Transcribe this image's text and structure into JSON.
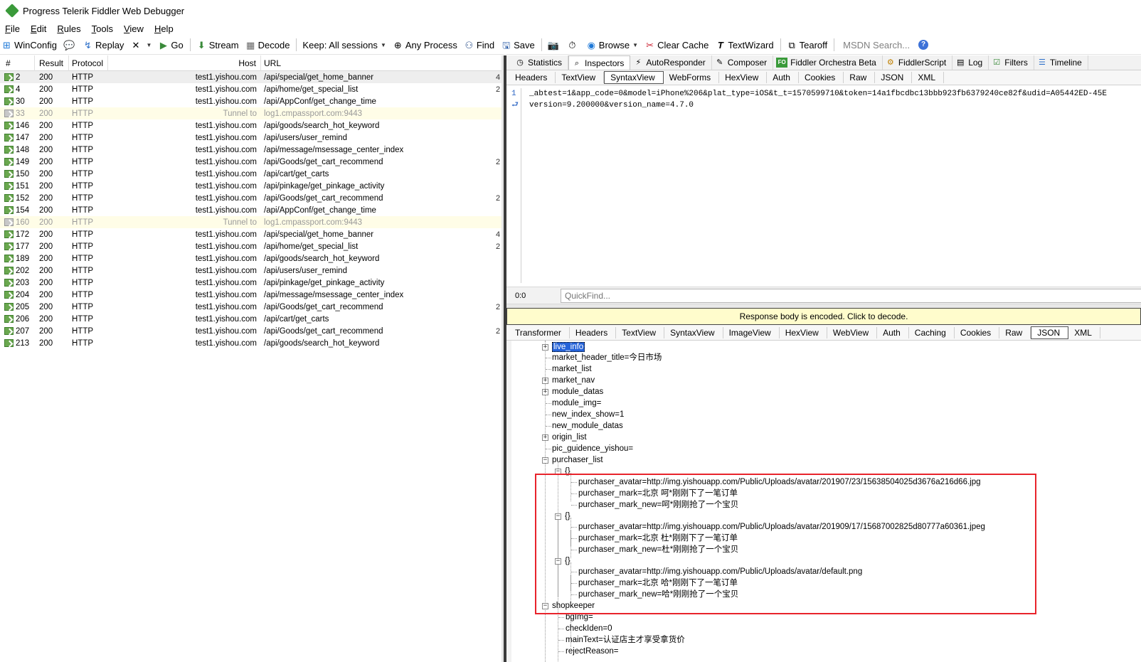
{
  "window": {
    "title": "Progress Telerik Fiddler Web Debugger"
  },
  "menu": [
    "File",
    "Edit",
    "Rules",
    "Tools",
    "View",
    "Help"
  ],
  "toolbar": {
    "winconfig": "WinConfig",
    "replay": "Replay",
    "go": "Go",
    "stream": "Stream",
    "decode": "Decode",
    "keep": "Keep: All sessions",
    "any_process": "Any Process",
    "find": "Find",
    "save": "Save",
    "browse": "Browse",
    "clear_cache": "Clear Cache",
    "textwizard": "TextWizard",
    "tearoff": "Tearoff",
    "msdn_search": "MSDN Search..."
  },
  "sessions": {
    "columns": {
      "num": "#",
      "result": "Result",
      "protocol": "Protocol",
      "host": "Host",
      "url": "URL"
    },
    "rows": [
      {
        "num": "2",
        "result": "200",
        "protocol": "HTTP",
        "host": "test1.yishou.com",
        "url": "/api/special/get_home_banner",
        "trunc": "4"
      },
      {
        "num": "4",
        "result": "200",
        "protocol": "HTTP",
        "host": "test1.yishou.com",
        "url": "/api/home/get_special_list",
        "trunc": "2"
      },
      {
        "num": "30",
        "result": "200",
        "protocol": "HTTP",
        "host": "test1.yishou.com",
        "url": "/api/AppConf/get_change_time",
        "trunc": ""
      },
      {
        "num": "33",
        "result": "200",
        "protocol": "HTTP",
        "host": "Tunnel to",
        "url": "log1.cmpassport.com:9443",
        "trunc": "",
        "tunnel": true
      },
      {
        "num": "146",
        "result": "200",
        "protocol": "HTTP",
        "host": "test1.yishou.com",
        "url": "/api/goods/search_hot_keyword",
        "trunc": ""
      },
      {
        "num": "147",
        "result": "200",
        "protocol": "HTTP",
        "host": "test1.yishou.com",
        "url": "/api/users/user_remind",
        "trunc": ""
      },
      {
        "num": "148",
        "result": "200",
        "protocol": "HTTP",
        "host": "test1.yishou.com",
        "url": "/api/message/msessage_center_index",
        "trunc": ""
      },
      {
        "num": "149",
        "result": "200",
        "protocol": "HTTP",
        "host": "test1.yishou.com",
        "url": "/api/Goods/get_cart_recommend",
        "trunc": "2"
      },
      {
        "num": "150",
        "result": "200",
        "protocol": "HTTP",
        "host": "test1.yishou.com",
        "url": "/api/cart/get_carts",
        "trunc": ""
      },
      {
        "num": "151",
        "result": "200",
        "protocol": "HTTP",
        "host": "test1.yishou.com",
        "url": "/api/pinkage/get_pinkage_activity",
        "trunc": ""
      },
      {
        "num": "152",
        "result": "200",
        "protocol": "HTTP",
        "host": "test1.yishou.com",
        "url": "/api/Goods/get_cart_recommend",
        "trunc": "2"
      },
      {
        "num": "154",
        "result": "200",
        "protocol": "HTTP",
        "host": "test1.yishou.com",
        "url": "/api/AppConf/get_change_time",
        "trunc": ""
      },
      {
        "num": "160",
        "result": "200",
        "protocol": "HTTP",
        "host": "Tunnel to",
        "url": "log1.cmpassport.com:9443",
        "trunc": "",
        "tunnel": true
      },
      {
        "num": "172",
        "result": "200",
        "protocol": "HTTP",
        "host": "test1.yishou.com",
        "url": "/api/special/get_home_banner",
        "trunc": "4"
      },
      {
        "num": "177",
        "result": "200",
        "protocol": "HTTP",
        "host": "test1.yishou.com",
        "url": "/api/home/get_special_list",
        "trunc": "2"
      },
      {
        "num": "189",
        "result": "200",
        "protocol": "HTTP",
        "host": "test1.yishou.com",
        "url": "/api/goods/search_hot_keyword",
        "trunc": ""
      },
      {
        "num": "202",
        "result": "200",
        "protocol": "HTTP",
        "host": "test1.yishou.com",
        "url": "/api/users/user_remind",
        "trunc": ""
      },
      {
        "num": "203",
        "result": "200",
        "protocol": "HTTP",
        "host": "test1.yishou.com",
        "url": "/api/pinkage/get_pinkage_activity",
        "trunc": ""
      },
      {
        "num": "204",
        "result": "200",
        "protocol": "HTTP",
        "host": "test1.yishou.com",
        "url": "/api/message/msessage_center_index",
        "trunc": ""
      },
      {
        "num": "205",
        "result": "200",
        "protocol": "HTTP",
        "host": "test1.yishou.com",
        "url": "/api/Goods/get_cart_recommend",
        "trunc": "2"
      },
      {
        "num": "206",
        "result": "200",
        "protocol": "HTTP",
        "host": "test1.yishou.com",
        "url": "/api/cart/get_carts",
        "trunc": ""
      },
      {
        "num": "207",
        "result": "200",
        "protocol": "HTTP",
        "host": "test1.yishou.com",
        "url": "/api/Goods/get_cart_recommend",
        "trunc": "2"
      },
      {
        "num": "213",
        "result": "200",
        "protocol": "HTTP",
        "host": "test1.yishou.com",
        "url": "/api/goods/search_hot_keyword",
        "trunc": ""
      }
    ]
  },
  "main_tabs": [
    "Statistics",
    "Inspectors",
    "AutoResponder",
    "Composer",
    "Fiddler Orchestra Beta",
    "FiddlerScript",
    "Log",
    "Filters",
    "Timeline"
  ],
  "fo_badge": "FO",
  "request_tabs": [
    "Headers",
    "TextView",
    "SyntaxView",
    "WebForms",
    "HexView",
    "Auth",
    "Cookies",
    "Raw",
    "JSON",
    "XML"
  ],
  "request_body": {
    "line_numbers": [
      "1"
    ],
    "lines": [
      "_abtest=1&app_code=0&model=iPhone%206&plat_type=iOS&t_t=1570599710&token=14a1fbcdbc13bbb923fb6379240ce82f&udid=A05442ED-45E",
      "version=9.200000&version_name=4.7.0"
    ]
  },
  "quickfind": {
    "position": "0:0",
    "placeholder": "QuickFind..."
  },
  "encoded_notice": "Response body is encoded. Click to decode.",
  "response_tabs": [
    "Transformer",
    "Headers",
    "TextView",
    "SyntaxView",
    "ImageView",
    "HexView",
    "WebView",
    "Auth",
    "Caching",
    "Cookies",
    "Raw",
    "JSON",
    "XML"
  ],
  "tree": {
    "live_info": "live_info",
    "market_header_title": "market_header_title=今日市场",
    "market_list": "market_list",
    "market_nav": "market_nav",
    "module_datas": "module_datas",
    "module_img": "module_img=",
    "new_index_show": "new_index_show=1",
    "new_module_datas": "new_module_datas",
    "origin_list": "origin_list",
    "pic_guidence_yishou": "pic_guidence_yishou=",
    "purchaser_list": "purchaser_list",
    "brace": "{}",
    "p1_avatar": "purchaser_avatar=http://img.yishouapp.com/Public/Uploads/avatar/201907/23/15638504025d3676a216d66.jpg",
    "p1_mark": "purchaser_mark=北京 呵*刚刚下了一笔订单",
    "p1_mark_new": "purchaser_mark_new=呵*刚刚抢了一个宝贝",
    "p2_avatar": "purchaser_avatar=http://img.yishouapp.com/Public/Uploads/avatar/201909/17/15687002825d80777a60361.jpeg",
    "p2_mark": "purchaser_mark=北京 杜*刚刚下了一笔订单",
    "p2_mark_new": "purchaser_mark_new=杜*刚刚抢了一个宝贝",
    "p3_avatar": "purchaser_avatar=http://img.yishouapp.com/Public/Uploads/avatar/default.png",
    "p3_mark": "purchaser_mark=北京 哈*刚刚下了一笔订单",
    "p3_mark_new": "purchaser_mark_new=哈*刚刚抢了一个宝贝",
    "shopkeeper": "shopkeeper",
    "bgImg": "bgImg=",
    "checkIden": "checkIden=0",
    "mainText": "mainText=认证店主才享受拿货价",
    "rejectReason": "rejectReason="
  },
  "colors": {
    "selection": "#2563d9",
    "highlight": "#e8232b",
    "notice_bg": "#fffccc"
  }
}
